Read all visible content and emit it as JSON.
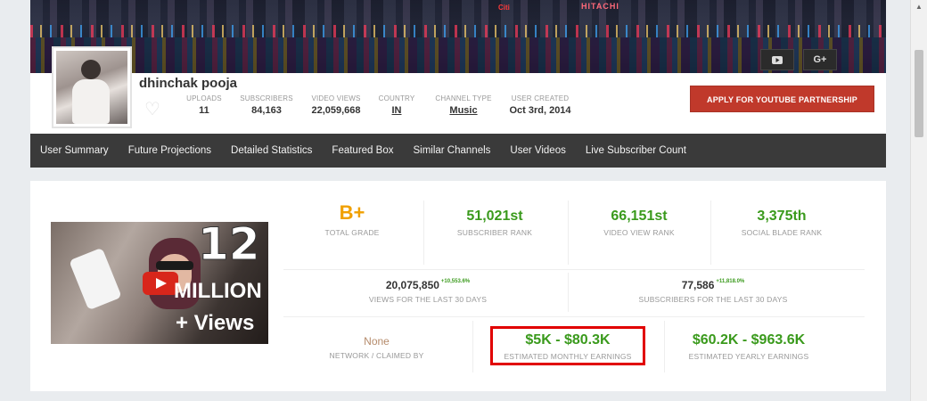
{
  "banner": {
    "sign_text": "HITACHI",
    "sign_text_2": "Citi",
    "youtube_icon": "youtube-icon",
    "googleplus_label": "G+"
  },
  "profile": {
    "channel_name": "dhinchak pooja",
    "stats": [
      {
        "label": "UPLOADS",
        "value": "11"
      },
      {
        "label": "SUBSCRIBERS",
        "value": "84,163"
      },
      {
        "label": "VIDEO VIEWS",
        "value": "22,059,668"
      },
      {
        "label": "COUNTRY",
        "value": "IN"
      },
      {
        "label": "CHANNEL TYPE",
        "value": "Music"
      },
      {
        "label": "USER CREATED",
        "value": "Oct 3rd, 2014"
      }
    ],
    "partner_button": "APPLY FOR YOUTUBE PARTNERSHIP"
  },
  "nav": {
    "items": [
      "User Summary",
      "Future Projections",
      "Detailed Statistics",
      "Featured Box",
      "Similar Channels",
      "User Videos",
      "Live Subscriber Count"
    ]
  },
  "thumbnail": {
    "big_number": "12",
    "line1": "MILLION",
    "line2": "+ Views"
  },
  "summary": {
    "grade": {
      "value": "B+",
      "label": "TOTAL GRADE"
    },
    "subscriber_rank": {
      "value": "51,021st",
      "label": "SUBSCRIBER RANK"
    },
    "video_view_rank": {
      "value": "66,151st",
      "label": "VIDEO VIEW RANK"
    },
    "socialblade_rank": {
      "value": "3,375th",
      "label": "SOCIAL BLADE RANK"
    },
    "views_30": {
      "value": "20,075,850",
      "change": "+10,553.6%",
      "label": "VIEWS FOR THE LAST 30 DAYS"
    },
    "subs_30": {
      "value": "77,586",
      "change": "+11,818.0%",
      "label": "SUBSCRIBERS FOR THE LAST 30 DAYS"
    },
    "network": {
      "value": "None",
      "label": "NETWORK / CLAIMED BY"
    },
    "monthly": {
      "value": "$5K - $80.3K",
      "label": "ESTIMATED MONTHLY EARNINGS"
    },
    "yearly": {
      "value": "$60.2K - $963.6K",
      "label": "ESTIMATED YEARLY EARNINGS"
    }
  },
  "colors": {
    "accent_green": "#3a9a1c",
    "grade_orange": "#f0a000",
    "partner_red": "#c0392b",
    "highlight_red": "#e10000",
    "nav_bg": "#3a3a3a"
  }
}
